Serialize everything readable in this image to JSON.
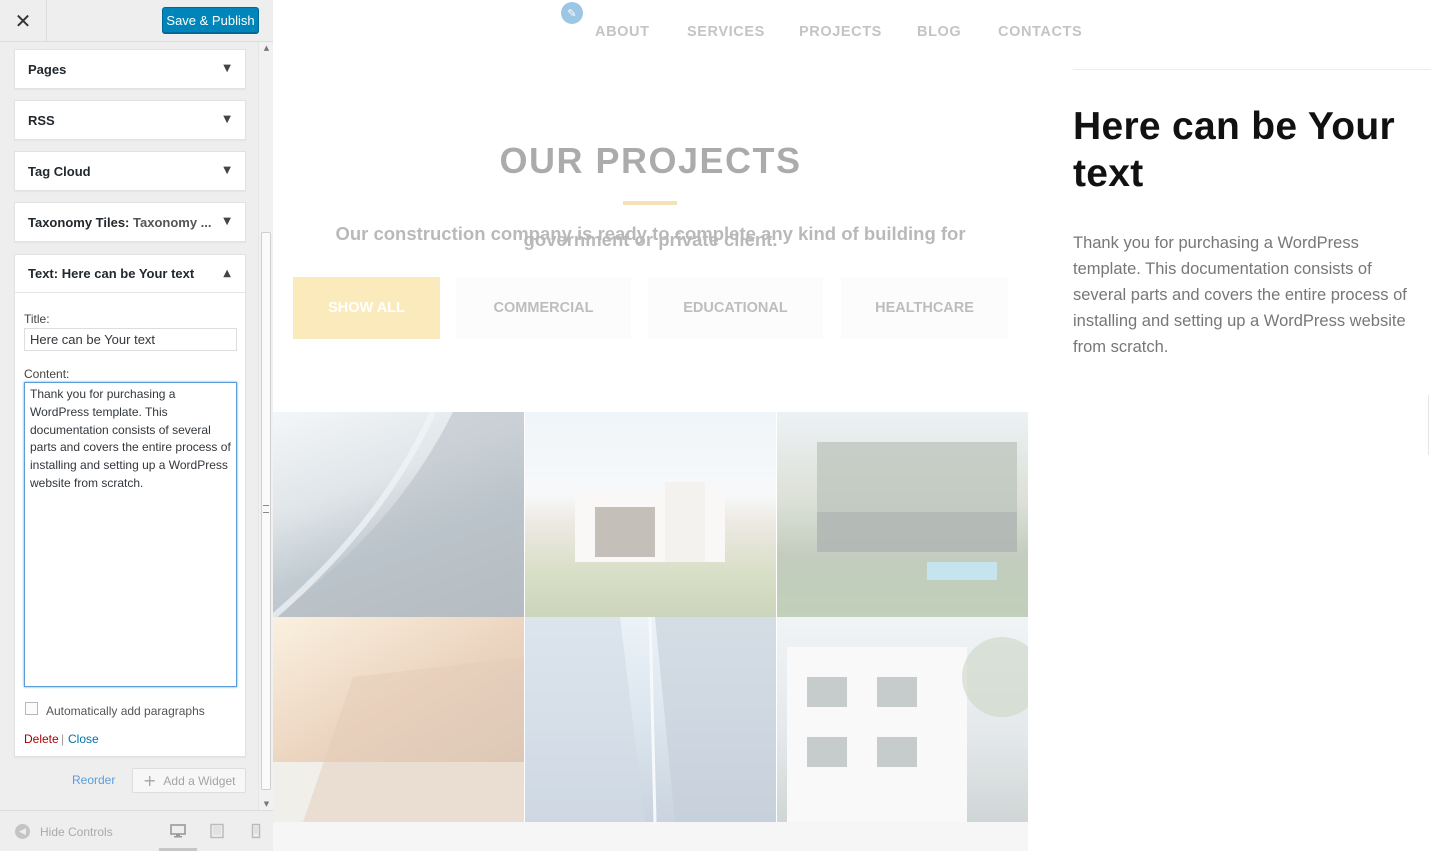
{
  "customizer": {
    "close_icon": "close-icon",
    "publish_label": "Save & Publish",
    "widgets": [
      {
        "title": "Pages",
        "subtitle": ""
      },
      {
        "title": "RSS",
        "subtitle": ""
      },
      {
        "title": "Tag Cloud",
        "subtitle": ""
      },
      {
        "title": "Taxonomy Tiles:",
        "subtitle": "Taxonomy ..."
      }
    ],
    "open_widget": {
      "title": "Text:",
      "subtitle": "Here can be Your text",
      "title_label": "Title:",
      "title_value": "Here can be Your text",
      "content_label": "Content:",
      "content_value": "Thank you for purchasing a WordPress template. This documentation consists of several parts and covers the entire process of installing and setting up a WordPress website from scratch.",
      "autop_label": "Automatically add paragraphs",
      "autop_checked": false,
      "delete_label": "Delete",
      "separator": "|",
      "close_label": "Close"
    },
    "reorder_label": "Reorder",
    "add_widget_label": "Add a Widget",
    "hide_controls_label": "Hide Controls",
    "devices": [
      "desktop",
      "tablet",
      "mobile"
    ],
    "active_device": "desktop"
  },
  "site": {
    "nav": [
      "ABOUT",
      "SERVICES",
      "PROJECTS",
      "BLOG",
      "CONTACTS"
    ],
    "projects_title": "OUR PROJECTS",
    "projects_subtitle": "Our construction company is ready to complete any kind of building for",
    "projects_subtitle2": "government or private client.",
    "filters": [
      "SHOW ALL",
      "COMMERCIAL",
      "EDUCATIONAL",
      "HEALTHCARE"
    ],
    "active_filter": "SHOW ALL",
    "text_widget_title": "Here can be Your text",
    "text_widget_body": "Thank you for purchasing a WordPress template. This documentation consists of several parts and covers the entire process of installing and setting up a WordPress website from scratch."
  },
  "colors": {
    "publish_button": "#0085ba",
    "accent_yellow": "#f5c842",
    "delete": "#aa0000",
    "link": "#0073aa"
  }
}
